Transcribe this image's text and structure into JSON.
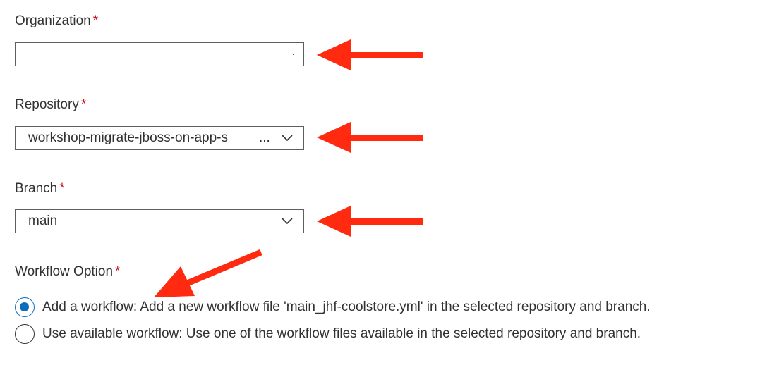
{
  "organization": {
    "label": "Organization",
    "required_mark": "*",
    "value": ""
  },
  "repository": {
    "label": "Repository",
    "required_mark": "*",
    "value": "workshop-migrate-jboss-on-app-s",
    "overflow": "..."
  },
  "branch": {
    "label": "Branch",
    "required_mark": "*",
    "value": "main"
  },
  "workflow_option": {
    "label": "Workflow Option",
    "required_mark": "*",
    "options": [
      {
        "label": "Add a workflow: Add a new workflow file 'main_jhf-coolstore.yml' in the selected repository and branch.",
        "selected": true
      },
      {
        "label": "Use available workflow: Use one of the workflow files available in the selected repository and branch.",
        "selected": false
      }
    ]
  },
  "annotations": {
    "arrow_color": "#ff2a0f",
    "icon": "arrow-annotation-icon"
  },
  "colors": {
    "accent": "#0f6cbd",
    "required": "#c50f1f",
    "text": "#323130",
    "border": "#605e5c"
  }
}
